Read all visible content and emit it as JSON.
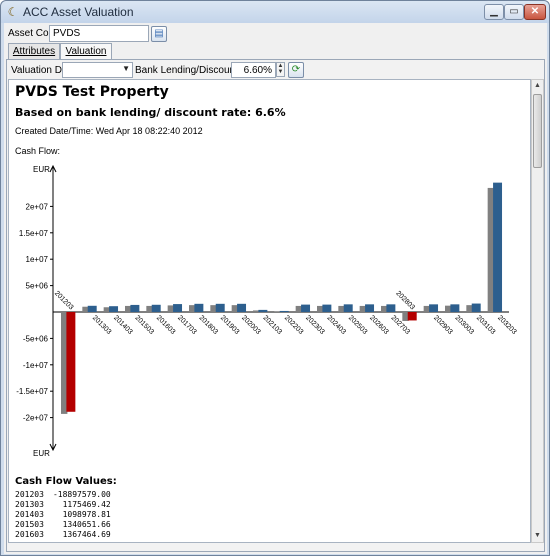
{
  "window": {
    "title": "ACC Asset Valuation"
  },
  "asset": {
    "code_label": "Asset Code",
    "code_value": "PVDS"
  },
  "tabs": [
    {
      "label": "Attributes"
    },
    {
      "label": "Valuation"
    }
  ],
  "valuation": {
    "date_label": "Valuation Date",
    "date_value": "",
    "rate_label": "Bank Lending/Discount Rate",
    "rate_value": "6.60%"
  },
  "report": {
    "title": "PVDS Test Property",
    "subtitle": "Based on bank lending/ discount rate: 6.6%",
    "created": "Created Date/Time: Wed Apr 18 08:22:40 2012",
    "cashflow_label": "Cash Flow:",
    "values_title": "Cash Flow Values:",
    "values": [
      {
        "period": "201203",
        "amount": "-18897579.00"
      },
      {
        "period": "201303",
        "amount": "1175469.42"
      },
      {
        "period": "201403",
        "amount": "1098978.81"
      },
      {
        "period": "201503",
        "amount": "1340651.66"
      },
      {
        "period": "201603",
        "amount": "1367464.69"
      }
    ]
  },
  "colors": {
    "positive": "#2d5f8e",
    "negative": "#b40000",
    "gray": "#808080"
  },
  "chart_data": {
    "type": "bar",
    "ylabel": "EUR",
    "ylabel_bottom": "EUR",
    "ylim": [
      -22000000.0,
      25000000.0
    ],
    "yticks": [
      {
        "value": 20000000,
        "label": "2e+07"
      },
      {
        "value": 15000000,
        "label": "1.5e+07"
      },
      {
        "value": 10000000,
        "label": "1e+07"
      },
      {
        "value": 5000000,
        "label": "5e+06"
      },
      {
        "value": -5000000,
        "label": "-5e+06"
      },
      {
        "value": -10000000,
        "label": "-1e+07"
      },
      {
        "value": -15000000,
        "label": "-1.5e+07"
      },
      {
        "value": -20000000,
        "label": "-2e+07"
      }
    ],
    "categories": [
      "201203",
      "201303",
      "201403",
      "201503",
      "201603",
      "201703",
      "201803",
      "201903",
      "202003",
      "202103",
      "202203",
      "202303",
      "202403",
      "202503",
      "202603",
      "202703",
      "202803",
      "202903",
      "203003",
      "203103",
      "203203"
    ],
    "series": [
      {
        "values": [
          -19300000,
          1000000,
          900000,
          1150000,
          1150000,
          1250000,
          1300000,
          1300000,
          1300000,
          300000,
          150000,
          1150000,
          1150000,
          1150000,
          1150000,
          1150000,
          -1700000,
          1150000,
          1200000,
          1300000,
          23500000
        ]
      },
      {
        "values": [
          -18897579,
          1175469,
          1098979,
          1340652,
          1367465,
          1500000,
          1550000,
          1550000,
          1550000,
          400000,
          200000,
          1400000,
          1400000,
          1450000,
          1450000,
          1450000,
          -1600000,
          1450000,
          1450000,
          1600000,
          24500000
        ]
      }
    ]
  }
}
